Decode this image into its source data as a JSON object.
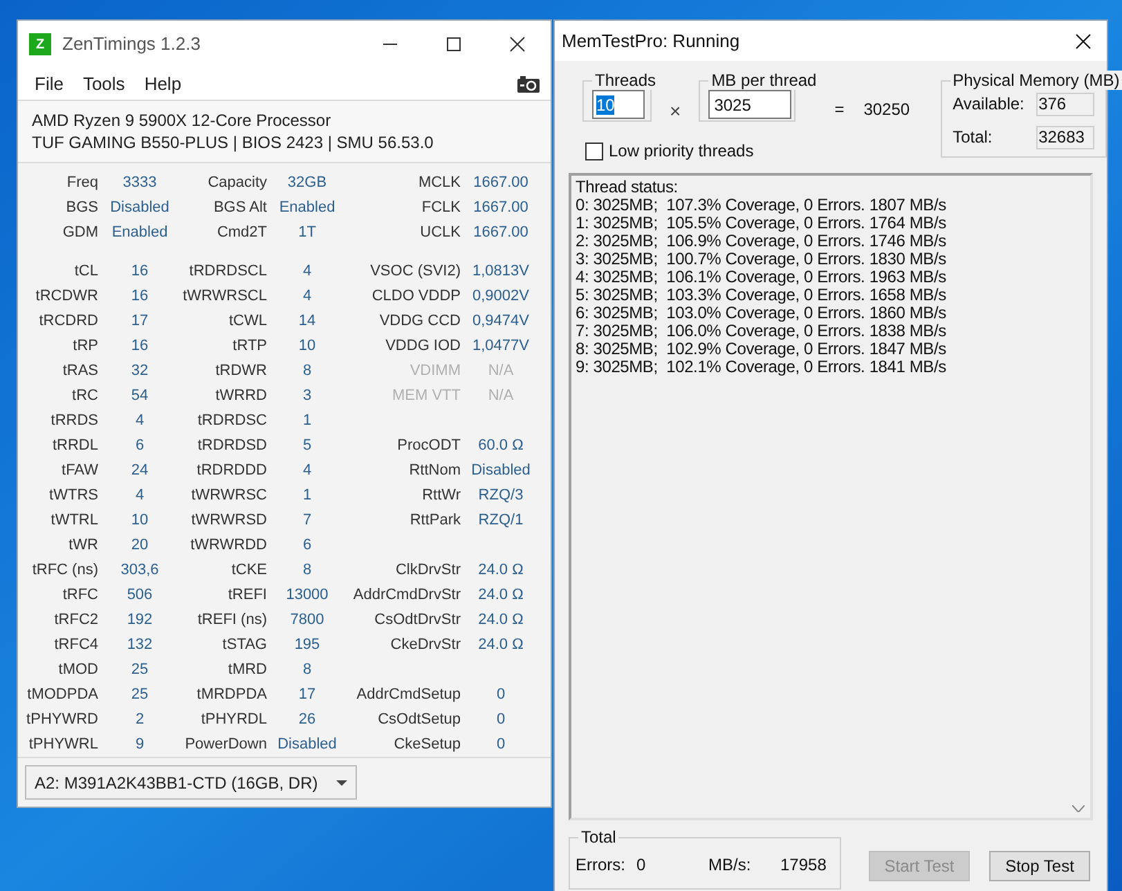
{
  "zentimings": {
    "title": "ZenTimings 1.2.3",
    "logo": "Z",
    "menu": [
      "File",
      "Tools",
      "Help"
    ],
    "processor": "AMD Ryzen 9 5900X 12-Core Processor",
    "board": "TUF GAMING B550-PLUS | BIOS 2423 | SMU 56.53.0",
    "sections": [
      {
        "rows": [
          [
            {
              "label": "Freq",
              "value": "3333",
              "disabled": false
            },
            {
              "label": "Capacity",
              "value": "32GB",
              "disabled": false
            },
            {
              "label": "MCLK",
              "value": "1667.00",
              "disabled": false
            }
          ],
          [
            {
              "label": "BGS",
              "value": "Disabled",
              "disabled": false
            },
            {
              "label": "BGS Alt",
              "value": "Enabled",
              "disabled": false
            },
            {
              "label": "FCLK",
              "value": "1667.00",
              "disabled": false
            }
          ],
          [
            {
              "label": "GDM",
              "value": "Enabled",
              "disabled": false
            },
            {
              "label": "Cmd2T",
              "value": "1T",
              "disabled": false
            },
            {
              "label": "UCLK",
              "value": "1667.00",
              "disabled": false
            }
          ]
        ]
      },
      {
        "rows": [
          [
            {
              "label": "tCL",
              "value": "16",
              "disabled": false
            },
            {
              "label": "tRDRDSCL",
              "value": "4",
              "disabled": false
            },
            {
              "label": "VSOC (SVI2)",
              "value": "1,0813V",
              "disabled": false
            }
          ],
          [
            {
              "label": "tRCDWR",
              "value": "16",
              "disabled": false
            },
            {
              "label": "tWRWRSCL",
              "value": "4",
              "disabled": false
            },
            {
              "label": "CLDO VDDP",
              "value": "0,9002V",
              "disabled": false
            }
          ],
          [
            {
              "label": "tRCDRD",
              "value": "17",
              "disabled": false
            },
            {
              "label": "tCWL",
              "value": "14",
              "disabled": false
            },
            {
              "label": "VDDG CCD",
              "value": "0,9474V",
              "disabled": false
            }
          ],
          [
            {
              "label": "tRP",
              "value": "16",
              "disabled": false
            },
            {
              "label": "tRTP",
              "value": "10",
              "disabled": false
            },
            {
              "label": "VDDG IOD",
              "value": "1,0477V",
              "disabled": false
            }
          ],
          [
            {
              "label": "tRAS",
              "value": "32",
              "disabled": false
            },
            {
              "label": "tRDWR",
              "value": "8",
              "disabled": false
            },
            {
              "label": "VDIMM",
              "value": "N/A",
              "disabled": true
            }
          ],
          [
            {
              "label": "tRC",
              "value": "54",
              "disabled": false
            },
            {
              "label": "tWRRD",
              "value": "3",
              "disabled": false
            },
            {
              "label": "MEM VTT",
              "value": "N/A",
              "disabled": true
            }
          ],
          [
            {
              "label": "tRRDS",
              "value": "4",
              "disabled": false
            },
            {
              "label": "tRDRDSC",
              "value": "1",
              "disabled": false
            },
            null
          ],
          [
            {
              "label": "tRRDL",
              "value": "6",
              "disabled": false
            },
            {
              "label": "tRDRDSD",
              "value": "5",
              "disabled": false
            },
            {
              "label": "ProcODT",
              "value": "60.0 Ω",
              "disabled": false
            }
          ],
          [
            {
              "label": "tFAW",
              "value": "24",
              "disabled": false
            },
            {
              "label": "tRDRDDD",
              "value": "4",
              "disabled": false
            },
            {
              "label": "RttNom",
              "value": "Disabled",
              "disabled": false
            }
          ],
          [
            {
              "label": "tWTRS",
              "value": "4",
              "disabled": false
            },
            {
              "label": "tWRWRSC",
              "value": "1",
              "disabled": false
            },
            {
              "label": "RttWr",
              "value": "RZQ/3",
              "disabled": false
            }
          ],
          [
            {
              "label": "tWTRL",
              "value": "10",
              "disabled": false
            },
            {
              "label": "tWRWRSD",
              "value": "7",
              "disabled": false
            },
            {
              "label": "RttPark",
              "value": "RZQ/1",
              "disabled": false
            }
          ],
          [
            {
              "label": "tWR",
              "value": "20",
              "disabled": false
            },
            {
              "label": "tWRWRDD",
              "value": "6",
              "disabled": false
            },
            null
          ],
          [
            {
              "label": "tRFC (ns)",
              "value": "303,6",
              "disabled": false
            },
            {
              "label": "tCKE",
              "value": "8",
              "disabled": false
            },
            {
              "label": "ClkDrvStr",
              "value": "24.0 Ω",
              "disabled": false
            }
          ],
          [
            {
              "label": "tRFC",
              "value": "506",
              "disabled": false
            },
            {
              "label": "tREFI",
              "value": "13000",
              "disabled": false
            },
            {
              "label": "AddrCmdDrvStr",
              "value": "24.0 Ω",
              "disabled": false
            }
          ],
          [
            {
              "label": "tRFC2",
              "value": "192",
              "disabled": false
            },
            {
              "label": "tREFI (ns)",
              "value": "7800",
              "disabled": false
            },
            {
              "label": "CsOdtDrvStr",
              "value": "24.0 Ω",
              "disabled": false
            }
          ],
          [
            {
              "label": "tRFC4",
              "value": "132",
              "disabled": false
            },
            {
              "label": "tSTAG",
              "value": "195",
              "disabled": false
            },
            {
              "label": "CkeDrvStr",
              "value": "24.0 Ω",
              "disabled": false
            }
          ],
          [
            {
              "label": "tMOD",
              "value": "25",
              "disabled": false
            },
            {
              "label": "tMRD",
              "value": "8",
              "disabled": false
            },
            null
          ],
          [
            {
              "label": "tMODPDA",
              "value": "25",
              "disabled": false
            },
            {
              "label": "tMRDPDA",
              "value": "17",
              "disabled": false
            },
            {
              "label": "AddrCmdSetup",
              "value": "0",
              "disabled": false
            }
          ],
          [
            {
              "label": "tPHYWRD",
              "value": "2",
              "disabled": false
            },
            {
              "label": "tPHYRDL",
              "value": "26",
              "disabled": false
            },
            {
              "label": "CsOdtSetup",
              "value": "0",
              "disabled": false
            }
          ],
          [
            {
              "label": "tPHYWRL",
              "value": "9",
              "disabled": false
            },
            {
              "label": "PowerDown",
              "value": "Disabled",
              "disabled": false
            },
            {
              "label": "CkeSetup",
              "value": "0",
              "disabled": false
            }
          ]
        ]
      }
    ],
    "module": "A2: M391A2K43BB1-CTD (16GB, DR)"
  },
  "memtest": {
    "title": "MemTestPro: Running",
    "threads": {
      "label": "Threads",
      "value": "10"
    },
    "times": "×",
    "mb_per_thread": {
      "label": "MB per thread",
      "value": "3025"
    },
    "equals": "=",
    "product": "30250",
    "physical_memory": {
      "label": "Physical Memory (MB)",
      "available_label": "Available:",
      "available": "376",
      "total_label": "Total:",
      "total": "32683"
    },
    "low_priority": {
      "label": "Low priority threads",
      "checked": false
    },
    "status_lines": [
      "Thread status:",
      "0: 3025MB;  107.3% Coverage, 0 Errors. 1807 MB/s",
      "1: 3025MB;  105.5% Coverage, 0 Errors. 1764 MB/s",
      "2: 3025MB;  106.9% Coverage, 0 Errors. 1746 MB/s",
      "3: 3025MB;  100.7% Coverage, 0 Errors. 1830 MB/s",
      "4: 3025MB;  106.1% Coverage, 0 Errors. 1963 MB/s",
      "5: 3025MB;  103.3% Coverage, 0 Errors. 1658 MB/s",
      "6: 3025MB;  103.0% Coverage, 0 Errors. 1860 MB/s",
      "7: 3025MB;  106.0% Coverage, 0 Errors. 1838 MB/s",
      "8: 3025MB;  102.9% Coverage, 0 Errors. 1847 MB/s",
      "9: 3025MB;  102.1% Coverage, 0 Errors. 1841 MB/s"
    ],
    "total": {
      "label": "Total",
      "errors_label": "Errors:",
      "errors": "0",
      "rate_label": "MB/s:",
      "rate": "17958"
    },
    "buttons": [
      {
        "label": "Start Test",
        "disabled": true
      },
      {
        "label": "Stop Test",
        "disabled": false
      }
    ]
  }
}
